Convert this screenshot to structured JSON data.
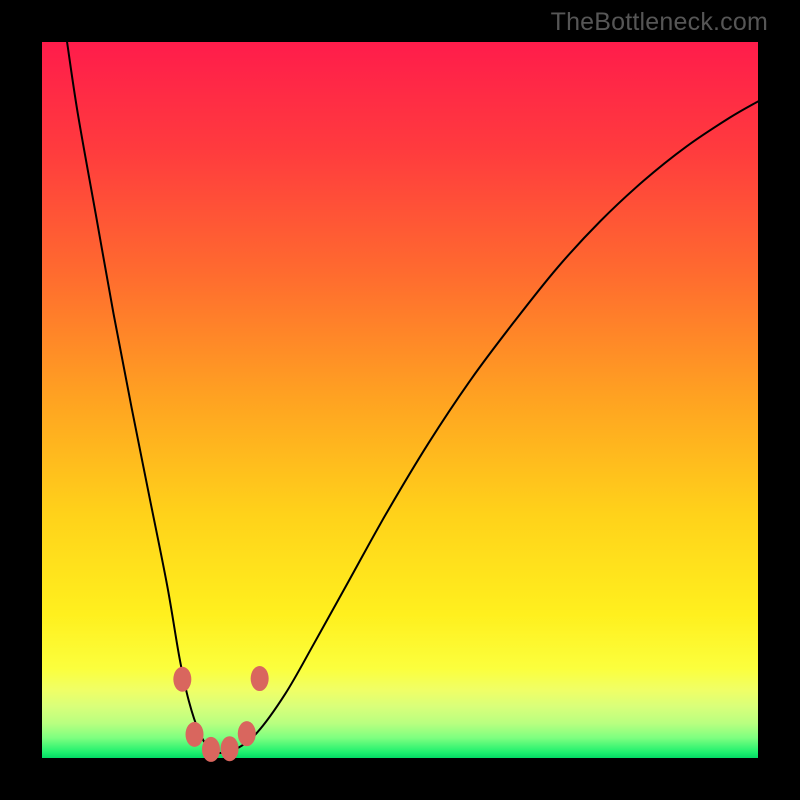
{
  "attribution": "TheBottleneck.com",
  "colors": {
    "frame": "#000000",
    "gradient_stops": [
      {
        "offset": 0.0,
        "color": "#ff1c4b"
      },
      {
        "offset": 0.15,
        "color": "#ff3b3e"
      },
      {
        "offset": 0.32,
        "color": "#ff6a2f"
      },
      {
        "offset": 0.5,
        "color": "#ffa321"
      },
      {
        "offset": 0.66,
        "color": "#ffd21a"
      },
      {
        "offset": 0.8,
        "color": "#fff01e"
      },
      {
        "offset": 0.875,
        "color": "#fbff3d"
      },
      {
        "offset": 0.905,
        "color": "#f0ff66"
      },
      {
        "offset": 0.928,
        "color": "#d9ff7a"
      },
      {
        "offset": 0.952,
        "color": "#b8ff80"
      },
      {
        "offset": 0.972,
        "color": "#7dff80"
      },
      {
        "offset": 0.992,
        "color": "#1ef06e"
      },
      {
        "offset": 1.0,
        "color": "#03da65"
      }
    ],
    "curve_stroke": "#000000",
    "dot_fill": "#d9665e"
  },
  "chart_data": {
    "type": "line",
    "title": "",
    "xlabel": "",
    "ylabel": "",
    "xlim": [
      0,
      100
    ],
    "ylim": [
      0,
      100
    ],
    "note": "Axes are unlabeled; values are relative percentages of plot width/height estimated from pixels. y=0 is the green bottom (good), y=100 is the red top (bad).",
    "series": [
      {
        "name": "bottleneck-curve",
        "x": [
          3.5,
          5,
          7.5,
          10,
          12.5,
          15,
          17.5,
          19.2,
          20.5,
          22,
          23.5,
          25,
          27,
          30,
          34,
          38,
          43,
          48,
          54,
          60,
          66,
          72,
          78,
          84,
          90,
          96,
          100
        ],
        "y": [
          100,
          90,
          76,
          62,
          49,
          36.5,
          24,
          14,
          8,
          3.5,
          1.2,
          0.7,
          1.2,
          3.5,
          9,
          16,
          25,
          34,
          44,
          53,
          61,
          68.5,
          75,
          80.6,
          85.4,
          89.4,
          91.7
        ]
      }
    ],
    "markers": [
      {
        "x": 19.6,
        "y": 11.0
      },
      {
        "x": 21.3,
        "y": 3.3
      },
      {
        "x": 23.6,
        "y": 1.2
      },
      {
        "x": 26.2,
        "y": 1.3
      },
      {
        "x": 28.6,
        "y": 3.4
      },
      {
        "x": 30.4,
        "y": 11.1
      }
    ]
  }
}
